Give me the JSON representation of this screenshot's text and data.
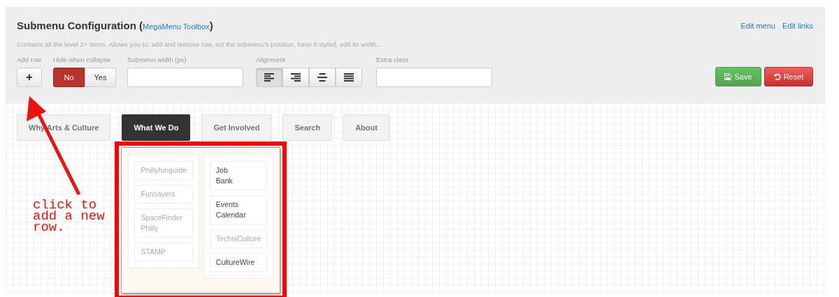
{
  "panel": {
    "title": "Submenu Configuration (",
    "title_link": "MegaMenu Toolbox",
    "title_end": ")",
    "links": [
      "Edit menu",
      "Edit links"
    ],
    "description": "Contains all the level 2+ items. Allows you to: add and remove row, set the submenu's position, have it styled, edit its width...",
    "add_row": {
      "label": "Add row",
      "button": "+"
    },
    "hide_when_collapse": {
      "label": "Hide when collapse",
      "options": [
        {
          "label": "No",
          "selected": true
        },
        {
          "label": "Yes",
          "selected": false
        }
      ]
    },
    "submenu_width": {
      "label": "Submenu width (px)"
    },
    "alignment": {
      "label": "Alignment",
      "options": [
        {
          "kind": "left",
          "selected": true
        },
        {
          "kind": "right",
          "selected": false
        },
        {
          "kind": "center",
          "selected": false
        },
        {
          "kind": "justify",
          "selected": false
        }
      ]
    },
    "extra_class": {
      "label": "Extra class"
    },
    "buttons": [
      {
        "kind": "save",
        "label": "Save"
      },
      {
        "kind": "reset",
        "label": "Reset"
      }
    ]
  },
  "menu": [
    {
      "label": "Why Arts & Culture",
      "selected": false
    },
    {
      "label": "What We Do",
      "selected": true
    },
    {
      "label": "Get Involved",
      "selected": false
    },
    {
      "label": "Search",
      "selected": false
    },
    {
      "label": "About",
      "selected": false
    }
  ],
  "submenu_columns": [
    {
      "items": [
        {
          "label": "Phillyfunguide",
          "dimmed": true
        },
        {
          "label": "Funsavers",
          "dimmed": true
        },
        {
          "label": "SpaceFinder Philly",
          "dimmed": true
        },
        {
          "label": "STAMP",
          "dimmed": true
        }
      ]
    },
    {
      "items": [
        {
          "label": "Job Bank",
          "dimmed": false
        },
        {
          "label": "Events Calendar",
          "dimmed": false
        },
        {
          "label": "TechniCulture",
          "dimmed": true
        },
        {
          "label": "CultureWire",
          "dimmed": false
        }
      ]
    }
  ],
  "annotation": {
    "text": "click to add a new row."
  }
}
